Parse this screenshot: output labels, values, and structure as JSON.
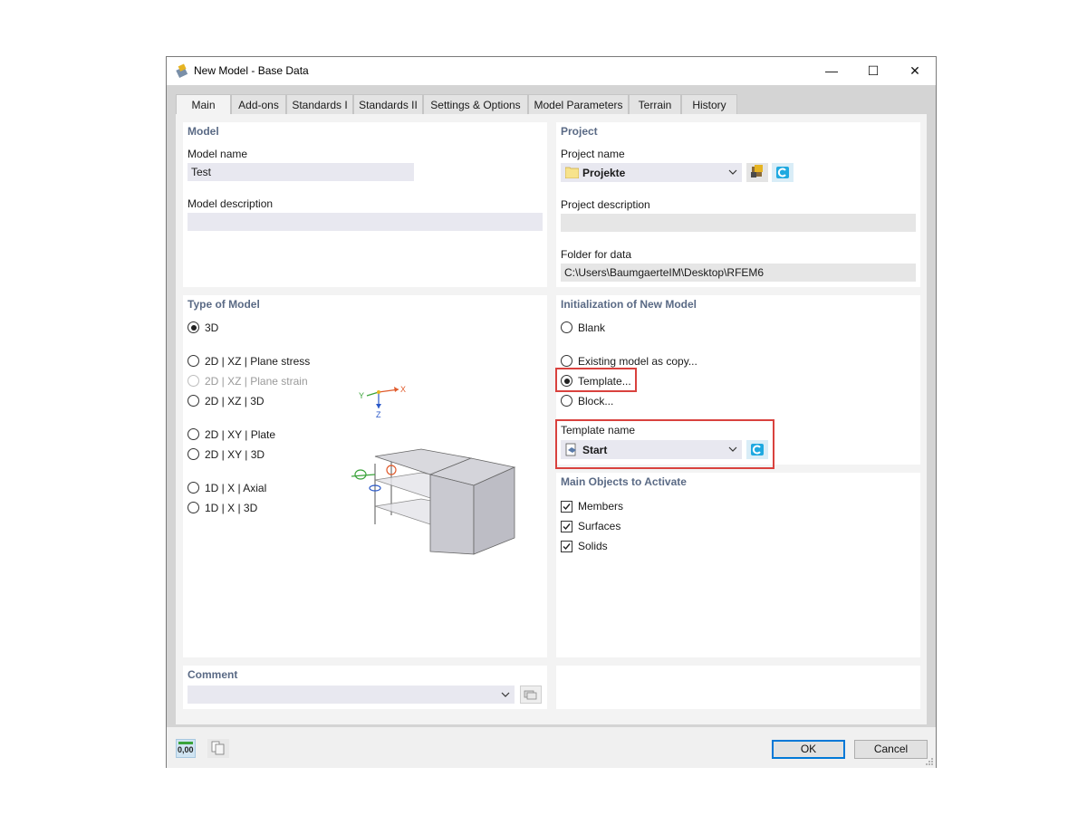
{
  "window": {
    "title": "New Model - Base Data",
    "controls": {
      "minimize": "—",
      "maximize": "☐",
      "close": "✕"
    }
  },
  "tabs": [
    "Main",
    "Add-ons",
    "Standards I",
    "Standards II",
    "Settings & Options",
    "Model Parameters",
    "Terrain",
    "History"
  ],
  "active_tab": "Main",
  "model": {
    "title": "Model",
    "name_label": "Model name",
    "name_value": "Test",
    "description_label": "Model description",
    "description_value": ""
  },
  "project": {
    "title": "Project",
    "name_label": "Project name",
    "name_value": "Projekte",
    "description_label": "Project description",
    "description_value": "",
    "folder_label": "Folder for data",
    "folder_value": "C:\\Users\\BaumgaerteIM\\Desktop\\RFEM6"
  },
  "model_type": {
    "title": "Type of Model",
    "options": [
      {
        "label": "3D",
        "selected": true,
        "enabled": true
      },
      {
        "label": "2D | XZ | Plane stress",
        "selected": false,
        "enabled": true
      },
      {
        "label": "2D | XZ | Plane strain",
        "selected": false,
        "enabled": false
      },
      {
        "label": "2D | XZ | 3D",
        "selected": false,
        "enabled": true
      },
      {
        "label": "2D | XY | Plate",
        "selected": false,
        "enabled": true
      },
      {
        "label": "2D | XY | 3D",
        "selected": false,
        "enabled": true
      },
      {
        "label": "1D | X | Axial",
        "selected": false,
        "enabled": true
      },
      {
        "label": "1D | X | 3D",
        "selected": false,
        "enabled": true
      }
    ],
    "axis_labels": {
      "x": "X",
      "y": "Y",
      "z": "Z"
    }
  },
  "initialization": {
    "title": "Initialization of New Model",
    "options": [
      {
        "label": "Blank",
        "selected": false
      },
      {
        "label": "Existing model as copy...",
        "selected": false
      },
      {
        "label": "Template...",
        "selected": true
      },
      {
        "label": "Block...",
        "selected": false
      }
    ],
    "template_label": "Template name",
    "template_value": "Start"
  },
  "main_objects": {
    "title": "Main Objects to Activate",
    "items": [
      {
        "label": "Members",
        "checked": true
      },
      {
        "label": "Surfaces",
        "checked": true
      },
      {
        "label": "Solids",
        "checked": true
      }
    ]
  },
  "comment": {
    "title": "Comment",
    "value": ""
  },
  "footer": {
    "units_badge": "0,00",
    "ok": "OK",
    "cancel": "Cancel"
  },
  "colors": {
    "highlight": "#d9423e",
    "section_title": "#5a6a85",
    "accent": "#0078d7"
  }
}
